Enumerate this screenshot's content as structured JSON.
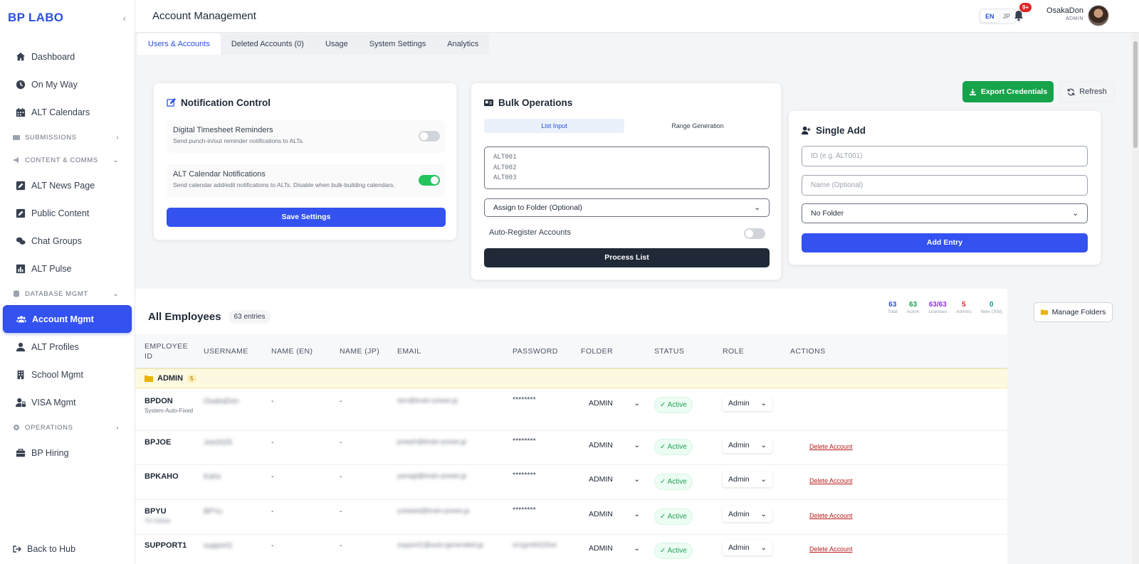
{
  "sidebar": {
    "logo": "BP LABO",
    "items": [
      {
        "label": "Dashboard"
      },
      {
        "label": "On My Way"
      },
      {
        "label": "ALT Calendars"
      }
    ],
    "sections": {
      "submissions": "SUBMISSIONS",
      "content": "CONTENT & COMMS",
      "database": "DATABASE MGMT",
      "operations": "OPERATIONS"
    },
    "content_items": [
      {
        "label": "ALT News Page"
      },
      {
        "label": "Public Content"
      },
      {
        "label": "Chat Groups"
      },
      {
        "label": "ALT Pulse"
      }
    ],
    "database_items": [
      {
        "label": "Account Mgmt"
      },
      {
        "label": "ALT Profiles"
      },
      {
        "label": "School Mgmt"
      },
      {
        "label": "VISA Mgmt"
      }
    ],
    "operations_items": [
      {
        "label": "BP Hiring"
      }
    ],
    "back": "Back to Hub"
  },
  "header": {
    "title": "Account Management",
    "lang_en": "EN",
    "lang_jp": "JP",
    "notif_badge": "9+",
    "user_name": "OsakaDon",
    "user_role": "ADMIN"
  },
  "tabs": [
    "Users & Accounts",
    "Deleted Accounts (0)",
    "Usage",
    "System Settings",
    "Analytics"
  ],
  "notification": {
    "title": "Notification Control",
    "row1_title": "Digital Timesheet Reminders",
    "row1_desc": "Send punch-in/out reminder notifications to ALTs.",
    "row1_on": false,
    "row2_title": "ALT Calendar Notifications",
    "row2_desc": "Send calendar add/edit notifications to ALTs. Disable when bulk-building calendars.",
    "row2_on": true,
    "save": "Save Settings"
  },
  "bulk": {
    "title": "Bulk Operations",
    "seg_list": "List Input",
    "seg_range": "Range Generation",
    "placeholder_lines": [
      "ALT001",
      "ALT002",
      "ALT003"
    ],
    "folder_select": "Assign to Folder (Optional)",
    "auto_register": "Auto-Register Accounts",
    "process": "Process List"
  },
  "actions": {
    "export": "Export Credentials",
    "refresh": "Refresh"
  },
  "single": {
    "title": "Single Add",
    "id_placeholder": "ID (e.g. ALT001)",
    "name_placeholder": "Name (Optional)",
    "folder": "No Folder",
    "add": "Add Entry"
  },
  "employees": {
    "title": "All Employees",
    "count": "63 entries",
    "stats": [
      {
        "value": "63",
        "label": "Total",
        "color": "#2b50e0"
      },
      {
        "value": "63",
        "label": "Active",
        "color": "#16a34a"
      },
      {
        "value": "63/63",
        "label": "Licenses",
        "color": "#9333ea"
      },
      {
        "value": "5",
        "label": "Admins",
        "color": "#dc2626"
      },
      {
        "value": "0",
        "label": "New (30d)",
        "color": "#0d9488"
      }
    ],
    "manage_folders": "Manage Folders",
    "columns": {
      "id": "EMPLOYEE ID",
      "username": "USERNAME",
      "name_en": "NAME (EN)",
      "name_jp": "NAME (JP)",
      "email": "EMAIL",
      "password": "PASSWORD",
      "folder": "FOLDER",
      "status": "STATUS",
      "role": "ROLE",
      "actions": "ACTIONS"
    },
    "folder_group": {
      "name": "ADMIN",
      "count": "5"
    },
    "rows": [
      {
        "id": "BPDON",
        "sub": "System-Auto-Fixed",
        "username": "OsakaDon",
        "name_en": "-",
        "name_jp": "-",
        "email": "don@brain-power.jp",
        "password": "********",
        "folder": "ADMIN",
        "status": "Active",
        "role": "Admin",
        "action": ""
      },
      {
        "id": "BPJOE",
        "sub": "",
        "username": "Joe2025",
        "name_en": "-",
        "name_jp": "-",
        "email": "joseph@brain-power.jp",
        "password": "********",
        "folder": "ADMIN",
        "status": "Active",
        "role": "Admin",
        "action": "Delete Account"
      },
      {
        "id": "BPKAHO",
        "sub": "",
        "username": "Kaho",
        "name_en": "-",
        "name_jp": "-",
        "email": "yanagi@brain-power.jp",
        "password": "********",
        "folder": "ADMIN",
        "status": "Active",
        "role": "Admin",
        "action": "Delete Account"
      },
      {
        "id": "BPYU",
        "sub": "YU Online",
        "username": "BPYu",
        "name_en": "-",
        "name_jp": "-",
        "email": "yukawa@brain-power.jp",
        "password": "********",
        "folder": "ADMIN",
        "status": "Active",
        "role": "Admin",
        "action": "Delete Account"
      },
      {
        "id": "SUPPORT1",
        "sub": "",
        "username": "support1",
        "name_en": "-",
        "name_jp": "-",
        "email": "support1@auto-generated.jp",
        "password": "sc1gm6022lsd",
        "folder": "ADMIN",
        "status": "Active",
        "role": "Admin",
        "action": "Delete Account"
      }
    ]
  },
  "colors": {
    "accent": "#3352f0",
    "success": "#16a34a",
    "danger": "#dc2626",
    "dark": "#1f2937"
  }
}
